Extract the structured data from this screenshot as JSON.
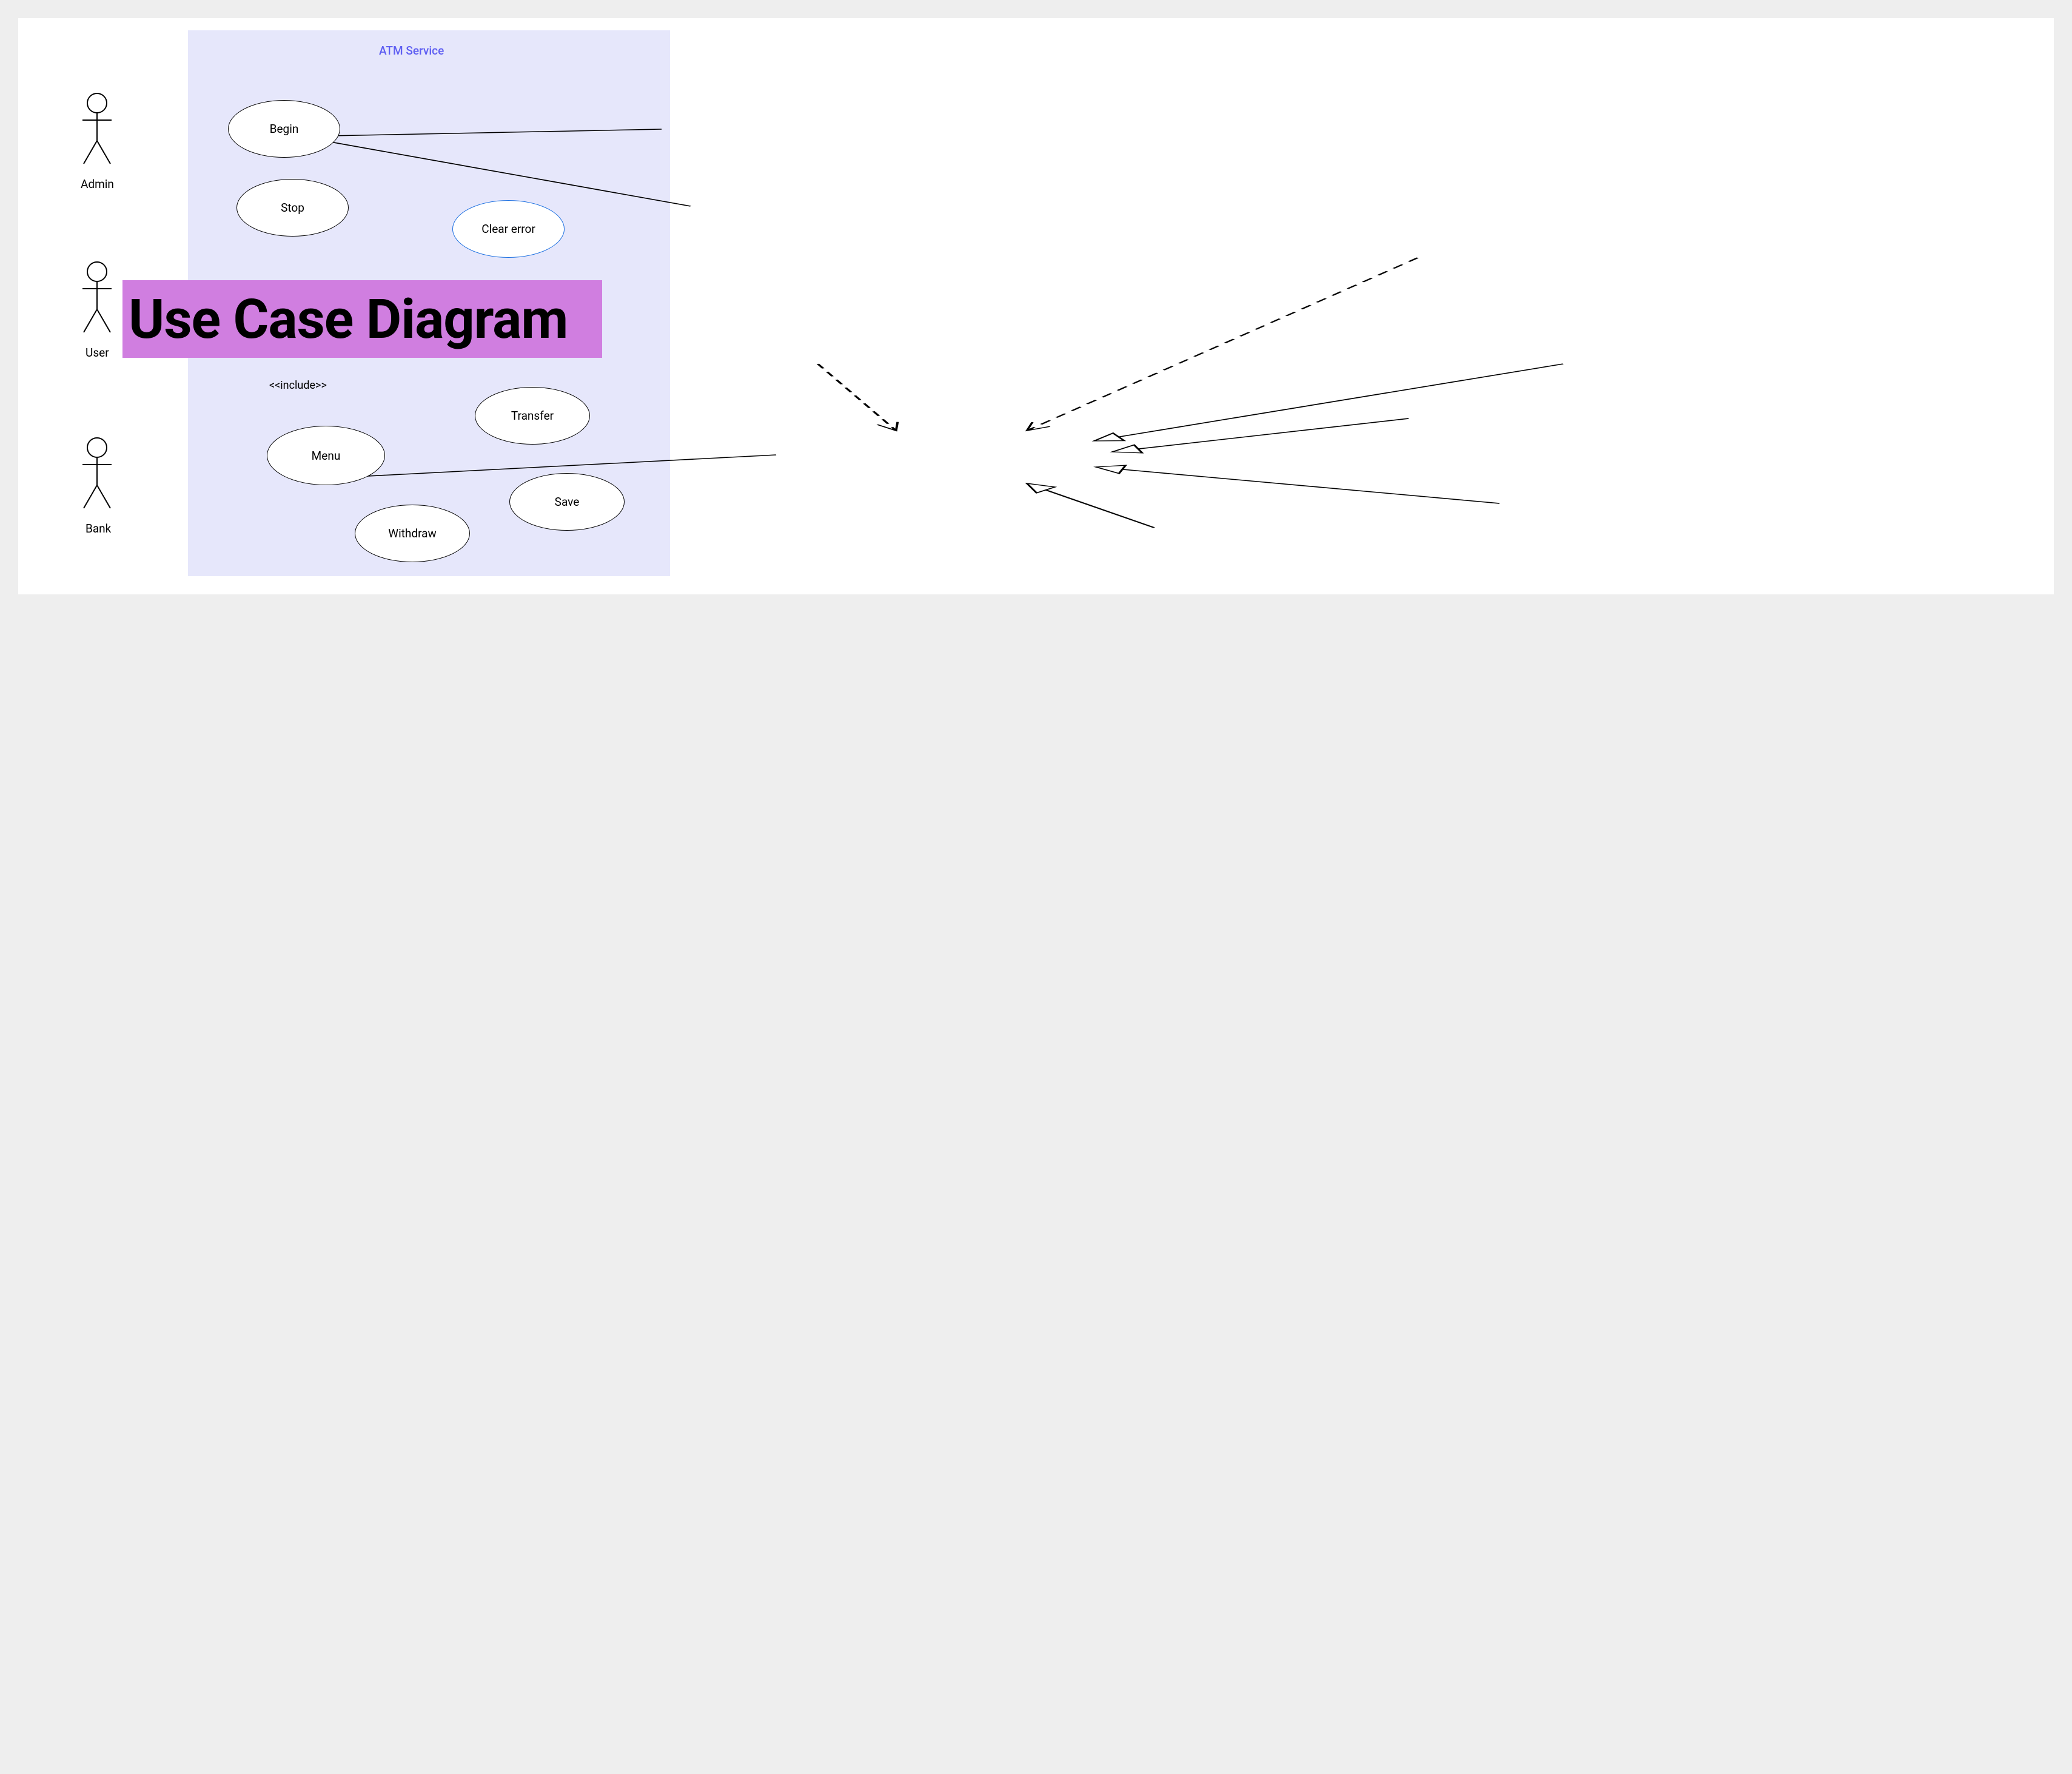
{
  "system": {
    "title": "ATM Service"
  },
  "actors": {
    "admin": "Admin",
    "user": "User",
    "bank": "Bank"
  },
  "usecases": {
    "begin": "Begin",
    "stop": "Stop",
    "clear_error": "Clear error",
    "menu": "Menu",
    "transfer": "Transfer",
    "save": "Save",
    "withdraw": "Withdraw"
  },
  "relations": {
    "include": "<<include>>"
  },
  "overlay": {
    "title": "Use Case Diagram"
  }
}
